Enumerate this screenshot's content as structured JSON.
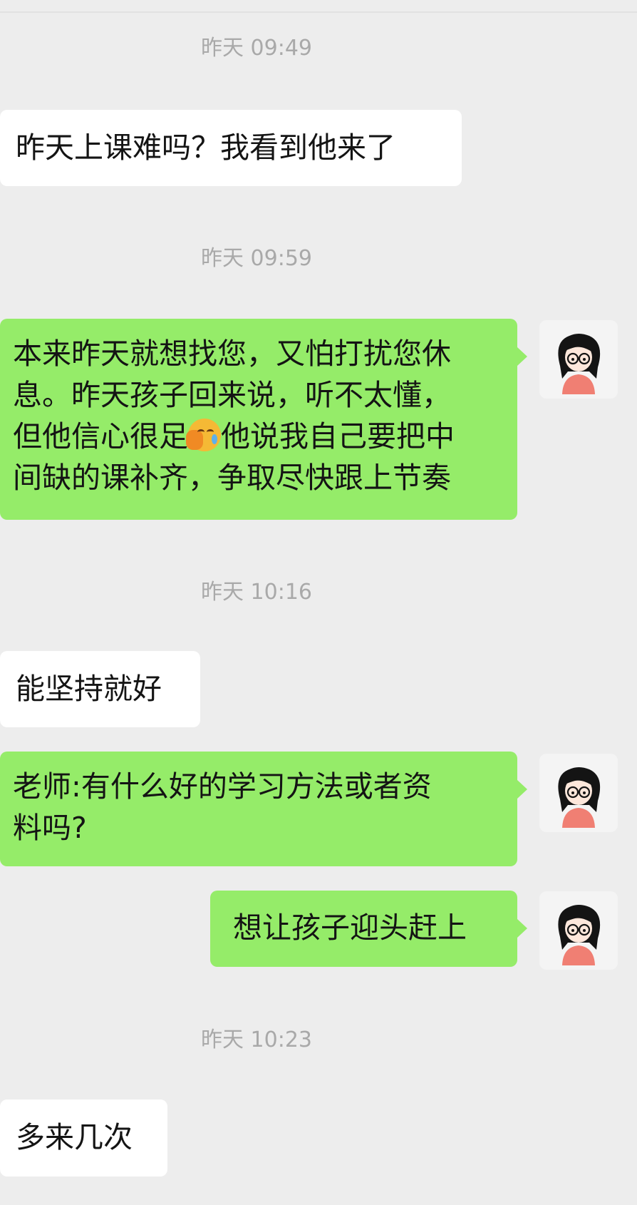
{
  "messages": [
    {
      "type": "timestamp",
      "text": "昨天 09:49"
    },
    {
      "type": "incoming",
      "lines": [
        "昨天上课难吗？我看到他来了"
      ]
    },
    {
      "type": "timestamp",
      "text": "昨天 09:59"
    },
    {
      "type": "outgoing",
      "lines": [
        "本来昨天就想找您，又怕打扰您休",
        "息。昨天孩子回来说，听不太懂，",
        "但他信心很足",
        "他说我自己要把中",
        "间缺的课补齐，争取尽快跟上节奏"
      ],
      "emoji": "face-palm-crying-laughing"
    },
    {
      "type": "timestamp",
      "text": "昨天 10:16"
    },
    {
      "type": "incoming",
      "lines": [
        "能坚持就好"
      ]
    },
    {
      "type": "outgoing",
      "lines": [
        "老师:有什么好的学习方法或者资",
        "料吗?"
      ]
    },
    {
      "type": "outgoing",
      "lines": [
        "想让孩子迎头赶上"
      ]
    },
    {
      "type": "timestamp",
      "text": "昨天 10:23"
    },
    {
      "type": "incoming",
      "lines": [
        "多来几次"
      ]
    }
  ],
  "avatar": {
    "icon": "cartoon-girl-avatar-icon",
    "hair_color": "#141414",
    "shirt_color": "#f07f73"
  },
  "colors": {
    "background": "#ededed",
    "incoming_bubble": "#ffffff",
    "outgoing_bubble": "#95ec69",
    "timestamp": "#a9a9a9"
  }
}
